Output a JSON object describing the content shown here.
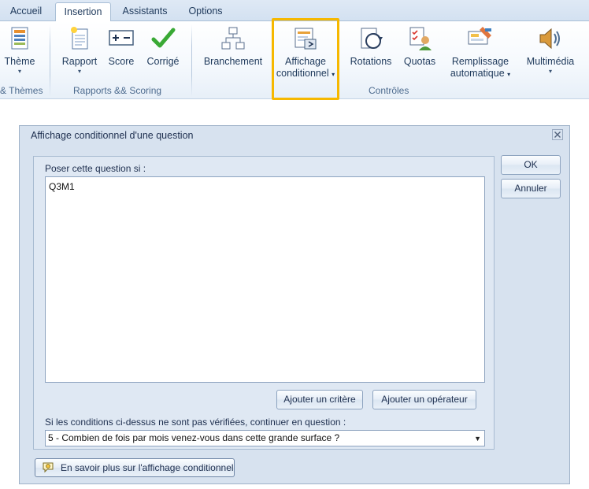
{
  "ribbon": {
    "tabs": [
      {
        "label": "Accueil"
      },
      {
        "label": "Insertion",
        "active": true
      },
      {
        "label": "Assistants"
      },
      {
        "label": "Options"
      }
    ],
    "buttons": {
      "theme": "Thème",
      "rapport": "Rapport",
      "score": "Score",
      "corrige": "Corrigé",
      "branchement": "Branchement",
      "affichage_l1": "Affichage",
      "affichage_l2": "conditionnel",
      "rotations": "Rotations",
      "quotas": "Quotas",
      "remplissage_l1": "Remplissage",
      "remplissage_l2": "automatique",
      "multimedia": "Multimédia"
    },
    "groups": {
      "themes": "& Thèmes",
      "rapports": "Rapports && Scoring",
      "controles": "Contrôles"
    },
    "highlight_color": "#f6b800"
  },
  "dialog": {
    "title": "Affichage conditionnel d'une question",
    "ask_label": "Poser cette question si :",
    "condition_text": "Q3M1",
    "add_criterion": "Ajouter un critère",
    "add_operator": "Ajouter un opérateur",
    "continue_label": "Si les conditions ci-dessus ne sont pas vérifiées, continuer en question :",
    "continue_value": "5 - Combien de fois par mois venez-vous dans cette grande surface ?",
    "ok": "OK",
    "cancel": "Annuler",
    "help": "En savoir plus sur l'affichage conditionnel"
  }
}
